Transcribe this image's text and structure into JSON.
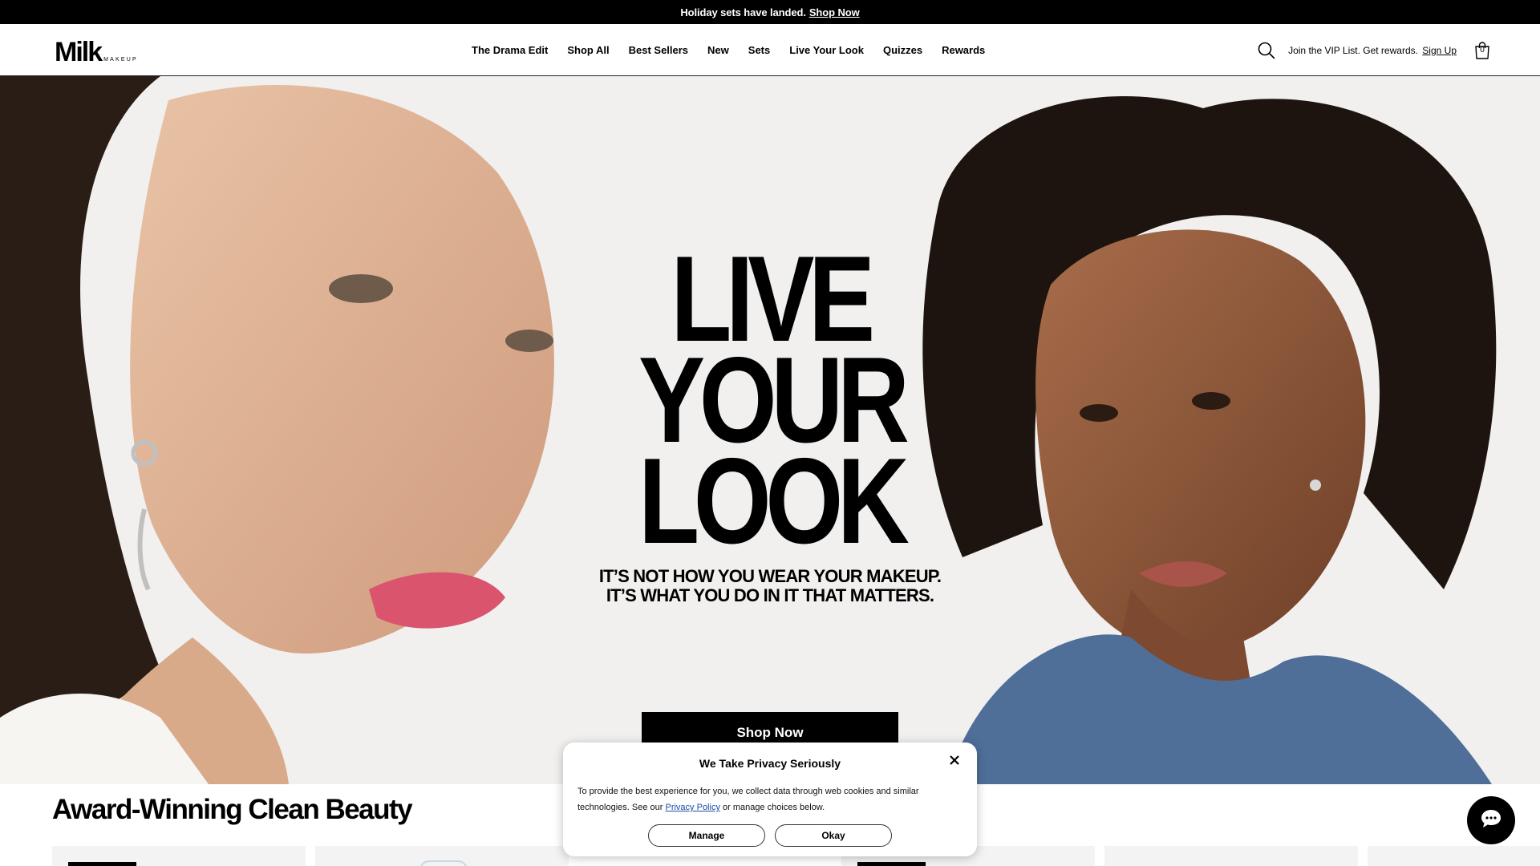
{
  "announcement": {
    "text": "Holiday sets have landed.",
    "link": "Shop Now"
  },
  "header": {
    "logo_main": "Milk",
    "logo_sub": "MAKEUP",
    "nav": [
      "The Drama Edit",
      "Shop All",
      "Best Sellers",
      "New",
      "Sets",
      "Live Your Look",
      "Quizzes",
      "Rewards"
    ],
    "vip_text": "Join the VIP List. Get rewards.",
    "vip_link": "Sign Up",
    "cart_count": "0"
  },
  "hero": {
    "title_lines": [
      "LIVE",
      "YOUR",
      "LOOK"
    ],
    "subtitle_lines": [
      "IT’S NOT HOW YOU WEAR YOUR MAKEUP.",
      "IT’S WHAT YOU DO IN IT THAT MATTERS."
    ],
    "cta": "Shop Now"
  },
  "section": {
    "title": "Award-Winning Clean Beauty"
  },
  "cookie": {
    "title": "We Take Privacy Seriously",
    "body_before": "To provide the best experience for you, we collect data through web cookies and similar technologies. See our",
    "link": "Privacy Policy",
    "body_after": "or manage choices below.",
    "manage": "Manage",
    "okay": "Okay"
  },
  "icons": [
    "search-icon",
    "bag-icon",
    "close-icon",
    "chat-icon"
  ],
  "colors": {
    "background": "#ffffff",
    "hero_bg": "#f1f0ef",
    "text": "#000000",
    "link_blue": "#1a4ba8"
  }
}
